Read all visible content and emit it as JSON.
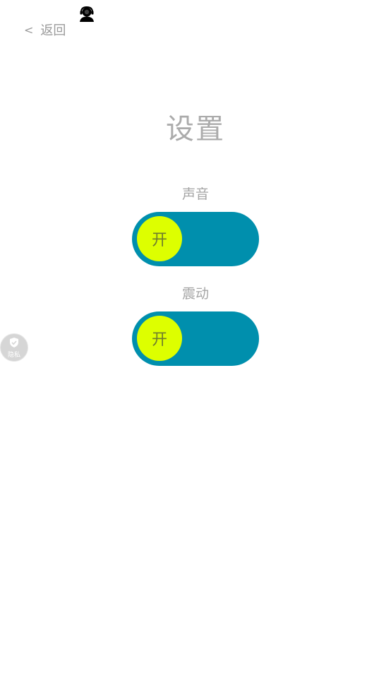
{
  "header": {
    "back_chevron": "<",
    "back_label": "返回",
    "support_icon": "customer-service-icon"
  },
  "page": {
    "title": "设置"
  },
  "settings": [
    {
      "label": "声音",
      "state_label": "开",
      "on": true
    },
    {
      "label": "震动",
      "state_label": "开",
      "on": true
    }
  ],
  "privacy": {
    "label": "隐私",
    "icon": "shield-icon"
  },
  "colors": {
    "toggle_track": "#008fad",
    "toggle_knob": "#ddff00",
    "text_muted": "#a5a5a5"
  }
}
